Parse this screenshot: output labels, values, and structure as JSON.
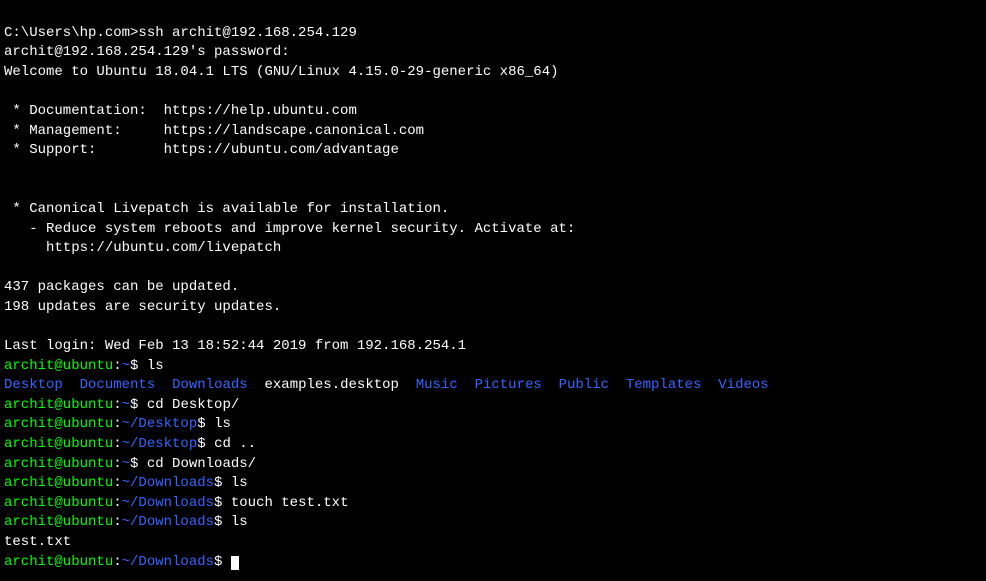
{
  "lines": {
    "ssh_cmd": "C:\\Users\\hp.com>ssh archit@192.168.254.129",
    "password_prompt": "archit@192.168.254.129's password:",
    "welcome": "Welcome to Ubuntu 18.04.1 LTS (GNU/Linux 4.15.0-29-generic x86_64)",
    "doc": " * Documentation:  https://help.ubuntu.com",
    "mgmt": " * Management:     https://landscape.canonical.com",
    "support": " * Support:        https://ubuntu.com/advantage",
    "livepatch1": " * Canonical Livepatch is available for installation.",
    "livepatch2": "   - Reduce system reboots and improve kernel security. Activate at:",
    "livepatch3": "     https://ubuntu.com/livepatch",
    "pkg1": "437 packages can be updated.",
    "pkg2": "198 updates are security updates.",
    "lastlogin": "Last login: Wed Feb 13 18:52:44 2019 from 192.168.254.1"
  },
  "prompts": {
    "user_host": "archit@ubuntu",
    "sep": ":",
    "home": "~",
    "desktop": "~/Desktop",
    "downloads": "~/Downloads",
    "dollar": "$ "
  },
  "commands": {
    "ls": "ls",
    "cd_desktop": "cd Desktop/",
    "cd_up": "cd ..",
    "cd_downloads": "cd Downloads/",
    "touch": "touch test.txt"
  },
  "ls_home": {
    "desktop": "Desktop",
    "documents": "Documents",
    "downloads": "Downloads",
    "examples": "examples.desktop",
    "music": "Music",
    "pictures": "Pictures",
    "public": "Public",
    "templates": "Templates",
    "videos": "Videos"
  },
  "output": {
    "testfile": "test.txt"
  }
}
